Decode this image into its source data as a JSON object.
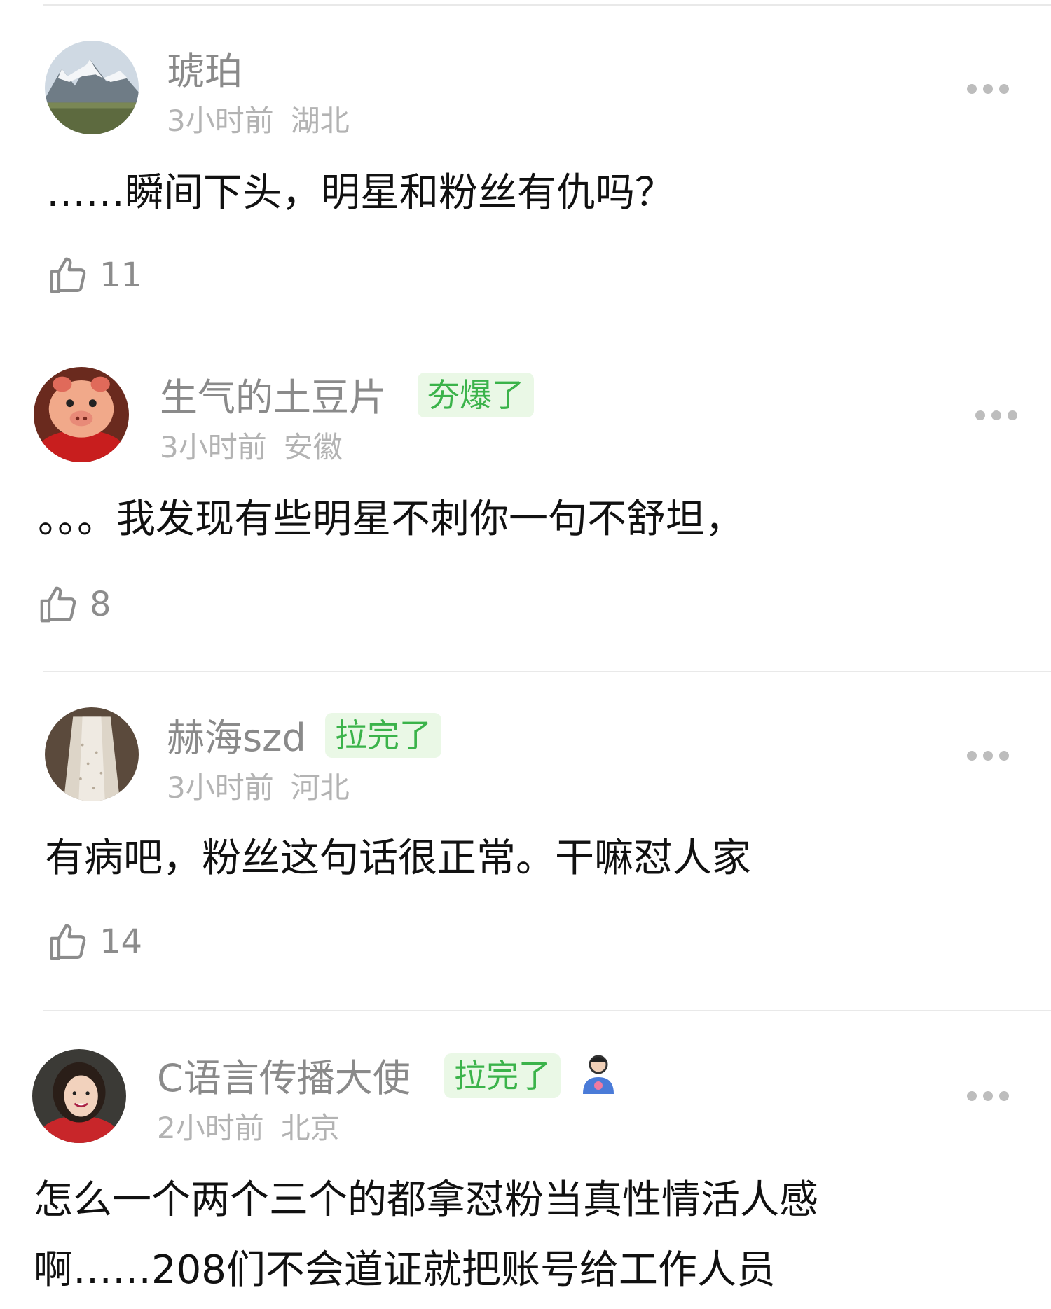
{
  "comments": [
    {
      "name": "琥珀",
      "badge": "",
      "time": "3小时前",
      "location": "湖北",
      "text": "……瞬间下头，明星和粉丝有仇吗？",
      "likes": "11"
    },
    {
      "name": "生气的土豆片",
      "badge": "夯爆了",
      "time": "3小时前",
      "location": "安徽",
      "text": "。。。我发现有些明星不刺你一句不舒坦，",
      "likes": "8"
    },
    {
      "name": "赫海szd",
      "badge": "拉完了",
      "time": "3小时前",
      "location": "河北",
      "text": "有病吧，粉丝这句话很正常。干嘛怼人家",
      "likes": "14"
    },
    {
      "name": "C语言传播大使",
      "badge": "拉完了",
      "time": "2小时前",
      "location": "北京",
      "text_line1": "怎么一个两个三个的都拿怼粉当真性情活人感",
      "text_line2": "啊……208们不会道证就把账号给工作人员"
    }
  ],
  "icons": {
    "like": "thumbs-up-icon",
    "more": "more-dots-icon"
  },
  "colors": {
    "badge_bg": "#eaf8e6",
    "badge_text": "#3bb34a",
    "name": "#8a8a8a",
    "meta": "#b3b3b3"
  }
}
